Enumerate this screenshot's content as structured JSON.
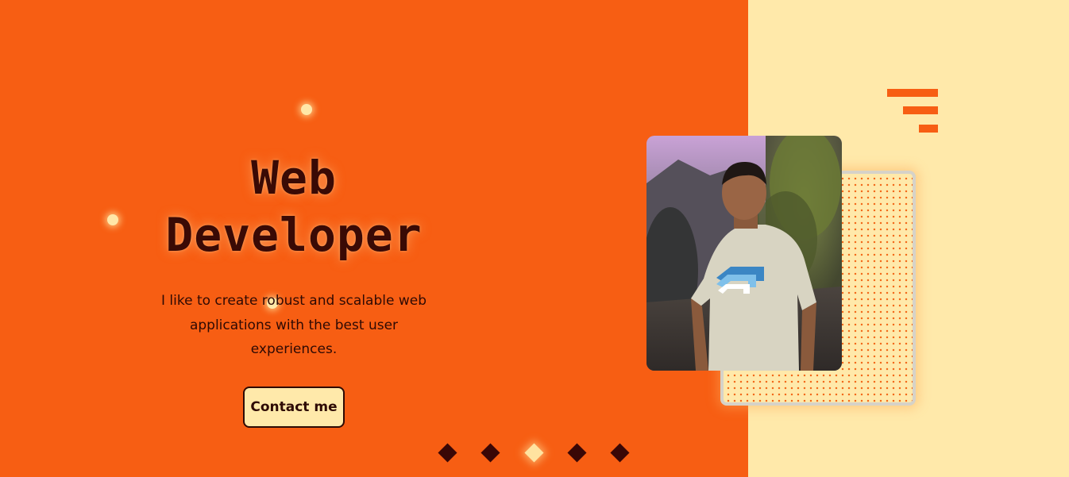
{
  "hero": {
    "title_line1": "Web",
    "title_line2": "Developer",
    "description": "I like to create robust and scalable web applications with the best user experiences.",
    "contact_label": "Contact me"
  },
  "pagination": {
    "count": 5,
    "active_index": 2
  },
  "icons": {
    "menu": "menu-icon",
    "photo": "profile-photo"
  },
  "colors": {
    "primary_orange": "#f75e13",
    "cream": "#ffe9aa",
    "dark_text": "#2e0a04",
    "diamond_inactive": "#3a0706",
    "diamond_active": "#ffe3a0"
  }
}
